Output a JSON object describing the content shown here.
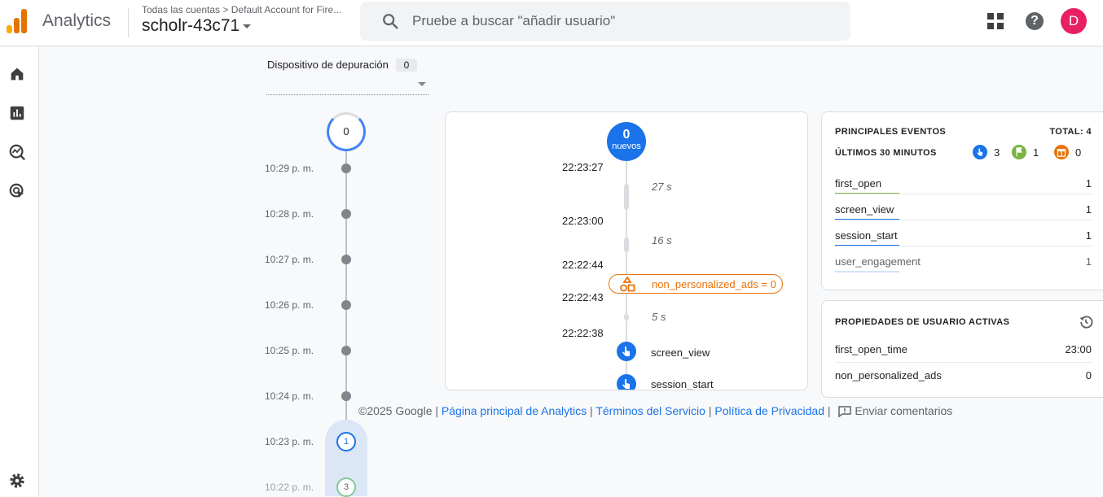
{
  "header": {
    "app_name": "Analytics",
    "breadcrumb": "Todas las cuentas > Default Account for Fire...",
    "property": "scholr-43c71",
    "search_placeholder": "Pruebe a buscar \"añadir usuario\"",
    "avatar_letter": "D",
    "help_glyph": "?"
  },
  "leftnav": {
    "icons": [
      "home-icon",
      "reports-icon",
      "explore-icon",
      "advertising-icon",
      "settings-icon"
    ]
  },
  "device": {
    "label": "Dispositivo de depuración",
    "count": "0"
  },
  "minutes": {
    "top_count": "0",
    "labels": [
      "10:29 p. m.",
      "10:28 p. m.",
      "10:27 p. m.",
      "10:26 p. m.",
      "10:25 p. m.",
      "10:24 p. m.",
      "10:23 p. m.",
      "10:22 p. m."
    ],
    "badge_1023": "1",
    "badge_1022": "3"
  },
  "seconds_stream": {
    "new_count": "0",
    "new_label": "nuevos",
    "timestamps": [
      "22:23:27",
      "22:23:00",
      "22:22:44",
      "22:22:43",
      "22:22:38"
    ],
    "gaps": [
      "27 s",
      "16 s",
      "5 s"
    ],
    "ad_event": "non_personalized_ads = 0",
    "events": [
      "screen_view",
      "session_start"
    ]
  },
  "top_events": {
    "title": "PRINCIPALES EVENTOS",
    "total": "TOTAL: 4",
    "subtitle": "ÚLTIMOS 30 MINUTOS",
    "counts": {
      "blue": "3",
      "green": "1",
      "orange": "0"
    },
    "rows": [
      {
        "name": "first_open",
        "value": "1",
        "color": "#7cb342"
      },
      {
        "name": "screen_view",
        "value": "1",
        "color": "#1a73e8"
      },
      {
        "name": "session_start",
        "value": "1",
        "color": "#1a73e8"
      },
      {
        "name": "user_engagement",
        "value": "1",
        "color": "#d2e3fc"
      }
    ]
  },
  "user_props": {
    "title": "PROPIEDADES DE USUARIO ACTIVAS",
    "rows": [
      {
        "name": "first_open_time",
        "value": "23:00"
      },
      {
        "name": "non_personalized_ads",
        "value": "0"
      }
    ]
  },
  "footer": {
    "copyright": "©2025 Google",
    "sep": "|",
    "home_link": "Página principal de Analytics",
    "terms_link": "Términos del Servicio",
    "privacy_link": "Política de Privacidad",
    "feedback": "Enviar comentarios"
  }
}
